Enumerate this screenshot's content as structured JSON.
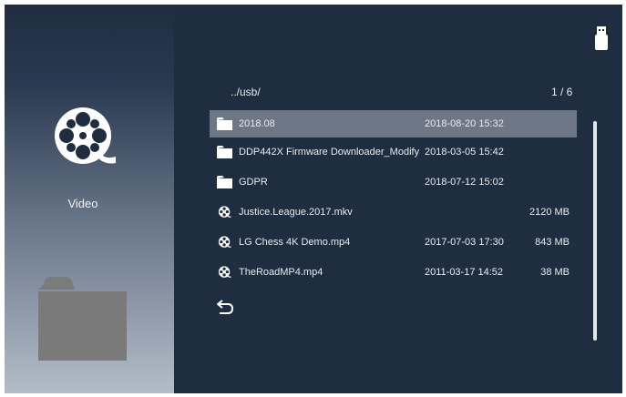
{
  "sidebar": {
    "category_label": "Video",
    "category_icon": "film-reel-icon",
    "secondary_icon": "folder-icon"
  },
  "browser": {
    "path": "../usb/",
    "page": "1 / 6",
    "files": [
      {
        "icon": "folder-icon",
        "name": "2018.08",
        "date": "2018-08-20 15:32",
        "size": "",
        "selected": true
      },
      {
        "icon": "folder-icon",
        "name": "DDP442X Firmware Downloader_Modify",
        "date": "2018-03-05 15:42",
        "size": "",
        "selected": false
      },
      {
        "icon": "folder-icon",
        "name": "GDPR",
        "date": "2018-07-12 15:02",
        "size": "",
        "selected": false
      },
      {
        "icon": "film-reel-icon",
        "name": "Justice.League.2017.mkv",
        "date": "",
        "size": "2120 MB",
        "selected": false
      },
      {
        "icon": "film-reel-icon",
        "name": "LG Chess 4K Demo.mp4",
        "date": "2017-07-03 17:30",
        "size": "843 MB",
        "selected": false
      },
      {
        "icon": "film-reel-icon",
        "name": "TheRoadMP4.mp4",
        "date": "2011-03-17 14:52",
        "size": "38 MB",
        "selected": false
      }
    ],
    "back_icon": "back-arrow-icon"
  },
  "status": {
    "usb_icon": "usb-drive-icon"
  },
  "colors": {
    "background": "#1f2d40",
    "selection": "#6e7786",
    "text": "#e8ebef"
  }
}
